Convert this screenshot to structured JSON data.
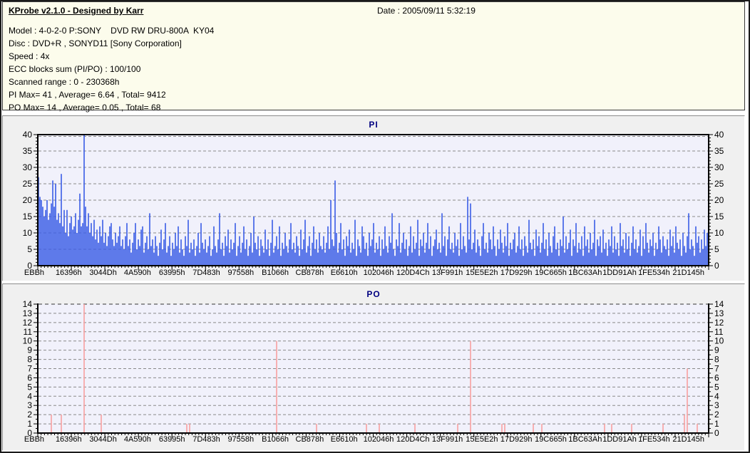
{
  "header": {
    "title": "KProbe v2.1.0 - Designed by Karr",
    "date_label": "Date : 2005/09/11 5:32:19",
    "info_lines": [
      "Model : 4-0-2-0 P:SONY    DVD RW DRU-800A  KY04",
      "Disc : DVD+R , SONYD11 [Sony Corporation]",
      "Speed : 4x",
      "ECC blocks sum (PI/PO) : 100/100",
      "Scanned range : 0 - 230368h",
      "PI Max= 41 , Average= 6.64 , Total= 9412",
      "PO Max= 14 , Average= 0.05 , Total= 68"
    ]
  },
  "colors": {
    "info_bg": "#FCFCEC",
    "panel_bg": "#F0F0F0",
    "plot_bg": "#F1F1FB",
    "grid": "#8a8a8a",
    "axis": "#000000",
    "title": "#000080",
    "pi_bar": "#3A5CE6",
    "po_bar": "#F8A0A0"
  },
  "chart_data": [
    {
      "type": "bar",
      "title": "PI",
      "ylim": [
        0,
        40
      ],
      "ytick_step": 5,
      "y_minor": 1,
      "grid": true,
      "legend": false,
      "bar_color": "#3A5CE6",
      "num_points": 470,
      "stats": {
        "max": 41,
        "average": 6.64,
        "total": 9412
      },
      "x_labels": [
        "EBBh",
        "16396h",
        "3044Dh",
        "4A590h",
        "63995h",
        "7D483h",
        "97558h",
        "B1066h",
        "CB878h",
        "E6610h",
        "102046h",
        "120D4Ch",
        "13F991h",
        "15E5E2h",
        "17D929h",
        "19C665h",
        "1BC63Ah",
        "1DD91Ah",
        "1FE534h",
        "21D145h"
      ],
      "values": [
        27,
        21,
        20,
        18,
        15,
        17,
        20,
        14,
        16,
        19,
        26,
        18,
        25,
        14,
        16,
        13,
        28,
        12,
        17,
        10,
        17,
        9,
        13,
        15,
        11,
        12,
        16,
        10,
        14,
        22,
        12,
        13,
        41,
        18,
        12,
        16,
        10,
        13,
        9,
        14,
        8,
        11,
        7,
        12,
        9,
        14,
        7,
        10,
        6,
        9,
        12,
        13,
        8,
        6,
        10,
        7,
        9,
        12,
        6,
        8,
        5,
        9,
        13,
        6,
        8,
        4,
        7,
        10,
        13,
        5,
        8,
        6,
        11,
        12,
        4,
        7,
        9,
        5,
        16,
        6,
        8,
        4,
        9,
        6,
        3,
        7,
        11,
        5,
        8,
        13,
        4,
        6,
        9,
        3,
        7,
        5,
        10,
        6,
        12,
        4,
        8,
        5,
        3,
        9,
        6,
        14,
        4,
        7,
        5,
        8,
        3,
        6,
        10,
        4,
        13,
        7,
        5,
        8,
        4,
        6,
        9,
        3,
        5,
        12,
        6,
        4,
        8,
        16,
        5,
        7,
        3,
        9,
        6,
        11,
        4,
        8,
        5,
        7,
        13,
        3,
        6,
        9,
        4,
        7,
        12,
        5,
        8,
        3,
        6,
        10,
        4,
        15,
        7,
        5,
        9,
        3,
        8,
        6,
        4,
        11,
        5,
        8,
        3,
        7,
        14,
        4,
        6,
        9,
        5,
        12,
        3,
        7,
        5,
        10,
        6,
        4,
        8,
        13,
        5,
        7,
        4,
        9,
        6,
        3,
        11,
        5,
        8,
        14,
        4,
        6,
        9,
        3,
        7,
        12,
        5,
        8,
        4,
        10,
        6,
        5,
        9,
        4,
        7,
        12,
        5,
        20,
        8,
        6,
        26,
        10,
        4,
        7,
        13,
        5,
        8,
        3,
        9,
        6,
        11,
        4,
        7,
        5,
        14,
        3,
        8,
        6,
        4,
        12,
        9,
        5,
        7,
        3,
        10,
        6,
        8,
        13,
        4,
        7,
        5,
        9,
        3,
        8,
        5,
        12,
        6,
        4,
        9,
        7,
        16,
        5,
        3,
        8,
        6,
        13,
        4,
        7,
        10,
        5,
        8,
        3,
        6,
        12,
        4,
        9,
        5,
        7,
        14,
        3,
        8,
        6,
        10,
        4,
        7,
        13,
        5,
        9,
        3,
        6,
        8,
        11,
        5,
        7,
        4,
        16,
        6,
        9,
        3,
        8,
        12,
        5,
        7,
        4,
        10,
        6,
        8,
        3,
        13,
        5,
        9,
        6,
        4,
        21,
        8,
        19,
        5,
        7,
        11,
        4,
        8,
        6,
        3,
        9,
        13,
        5,
        7,
        4,
        10,
        8,
        5,
        12,
        6,
        3,
        8,
        5,
        11,
        7,
        4,
        9,
        6,
        13,
        3,
        7,
        5,
        8,
        10,
        4,
        6,
        12,
        5,
        8,
        3,
        9,
        6,
        4,
        14,
        7,
        5,
        8,
        3,
        11,
        6,
        9,
        4,
        7,
        13,
        5,
        8,
        3,
        10,
        6,
        4,
        9,
        12,
        5,
        7,
        3,
        8,
        6,
        15,
        4,
        9,
        5,
        7,
        11,
        3,
        8,
        6,
        13,
        4,
        7,
        5,
        9,
        3,
        12,
        6,
        8,
        4,
        10,
        5,
        7,
        14,
        3,
        8,
        6,
        9,
        4,
        11,
        5,
        7,
        3,
        8,
        6,
        12,
        4,
        9,
        5,
        7,
        3,
        13,
        6,
        8,
        4,
        10,
        5,
        9,
        3,
        7,
        12,
        5,
        8,
        4,
        6,
        11,
        3,
        9,
        5,
        13,
        7,
        4,
        8,
        6,
        10,
        3,
        7,
        5,
        12,
        8,
        4,
        9,
        6,
        5,
        8,
        3,
        11,
        6,
        9,
        4,
        12,
        7,
        5,
        8,
        3,
        10,
        6,
        4,
        9,
        16,
        5,
        8,
        6,
        3,
        12,
        7,
        9,
        4,
        8,
        5,
        11,
        6,
        10
      ]
    },
    {
      "type": "bar",
      "title": "PO",
      "ylim": [
        0,
        14
      ],
      "ytick_step": 1,
      "y_minor": 0.5,
      "grid": true,
      "legend": false,
      "top_dashed_dark": true,
      "bar_color": "#F8A0A0",
      "num_points": 470,
      "stats": {
        "max": 14,
        "average": 0.05,
        "total": 68
      },
      "x_labels": [
        "EBBh",
        "16396h",
        "3044Dh",
        "4A590h",
        "63995h",
        "7D483h",
        "97558h",
        "B1066h",
        "CB878h",
        "E6610h",
        "102046h",
        "120D4Ch",
        "13F991h",
        "15E5E2h",
        "17D929h",
        "19C665h",
        "1BC63Ah",
        "1DD91Ah",
        "1FE534h",
        "21D145h"
      ],
      "values_sparse": [
        [
          9,
          2
        ],
        [
          16,
          2
        ],
        [
          32,
          14
        ],
        [
          44,
          2
        ],
        [
          104,
          1
        ],
        [
          106,
          1
        ],
        [
          167,
          10
        ],
        [
          195,
          1
        ],
        [
          230,
          1
        ],
        [
          239,
          1
        ],
        [
          264,
          1
        ],
        [
          294,
          1
        ],
        [
          303,
          10
        ],
        [
          325,
          1
        ],
        [
          327,
          1
        ],
        [
          347,
          1
        ],
        [
          353,
          1
        ],
        [
          397,
          1
        ],
        [
          402,
          1
        ],
        [
          416,
          1
        ],
        [
          438,
          1
        ],
        [
          453,
          2
        ],
        [
          455,
          7
        ],
        [
          462,
          1
        ]
      ]
    }
  ]
}
